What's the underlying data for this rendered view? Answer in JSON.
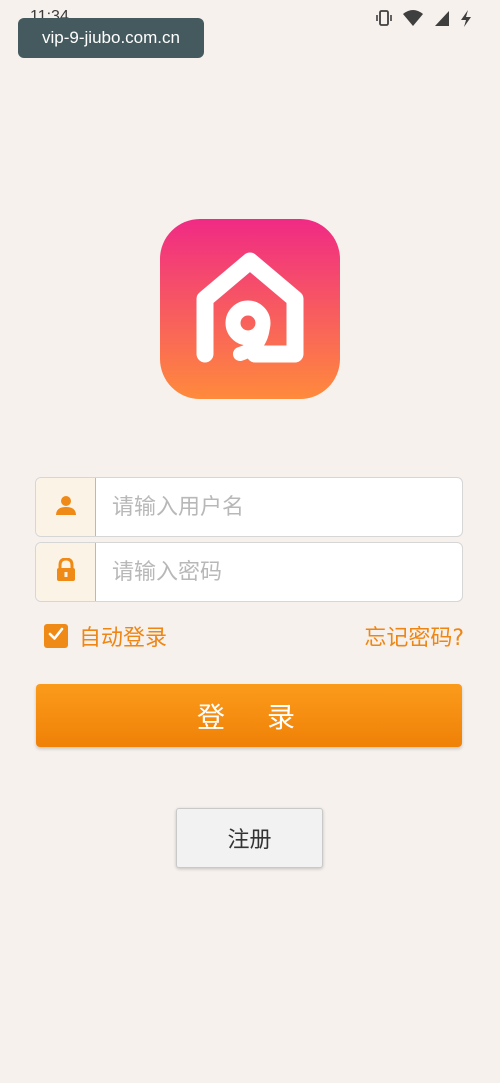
{
  "status_bar": {
    "time": "11:34",
    "icons": [
      "vibrate-icon",
      "wifi-icon",
      "signal-icon",
      "charging-icon"
    ]
  },
  "url_badge": {
    "text": "vip-9-jiubo.com.cn"
  },
  "app_logo": {
    "icon": "house-nine-logo",
    "gradient_top": "#f02a85",
    "gradient_bottom": "#ff8a3c"
  },
  "login_form": {
    "username": {
      "icon": "user-icon",
      "placeholder": "请输入用户名",
      "value": ""
    },
    "password": {
      "icon": "lock-icon",
      "placeholder": "请输入密码",
      "value": ""
    },
    "auto_login": {
      "label": "自动登录",
      "checked": true
    },
    "forgot_password": "忘记密码?",
    "login_button": "登录",
    "register_button": "注册"
  },
  "colors": {
    "accent": "#f08a17",
    "background": "#f6f1ed",
    "badge_background": "#455a5e"
  }
}
